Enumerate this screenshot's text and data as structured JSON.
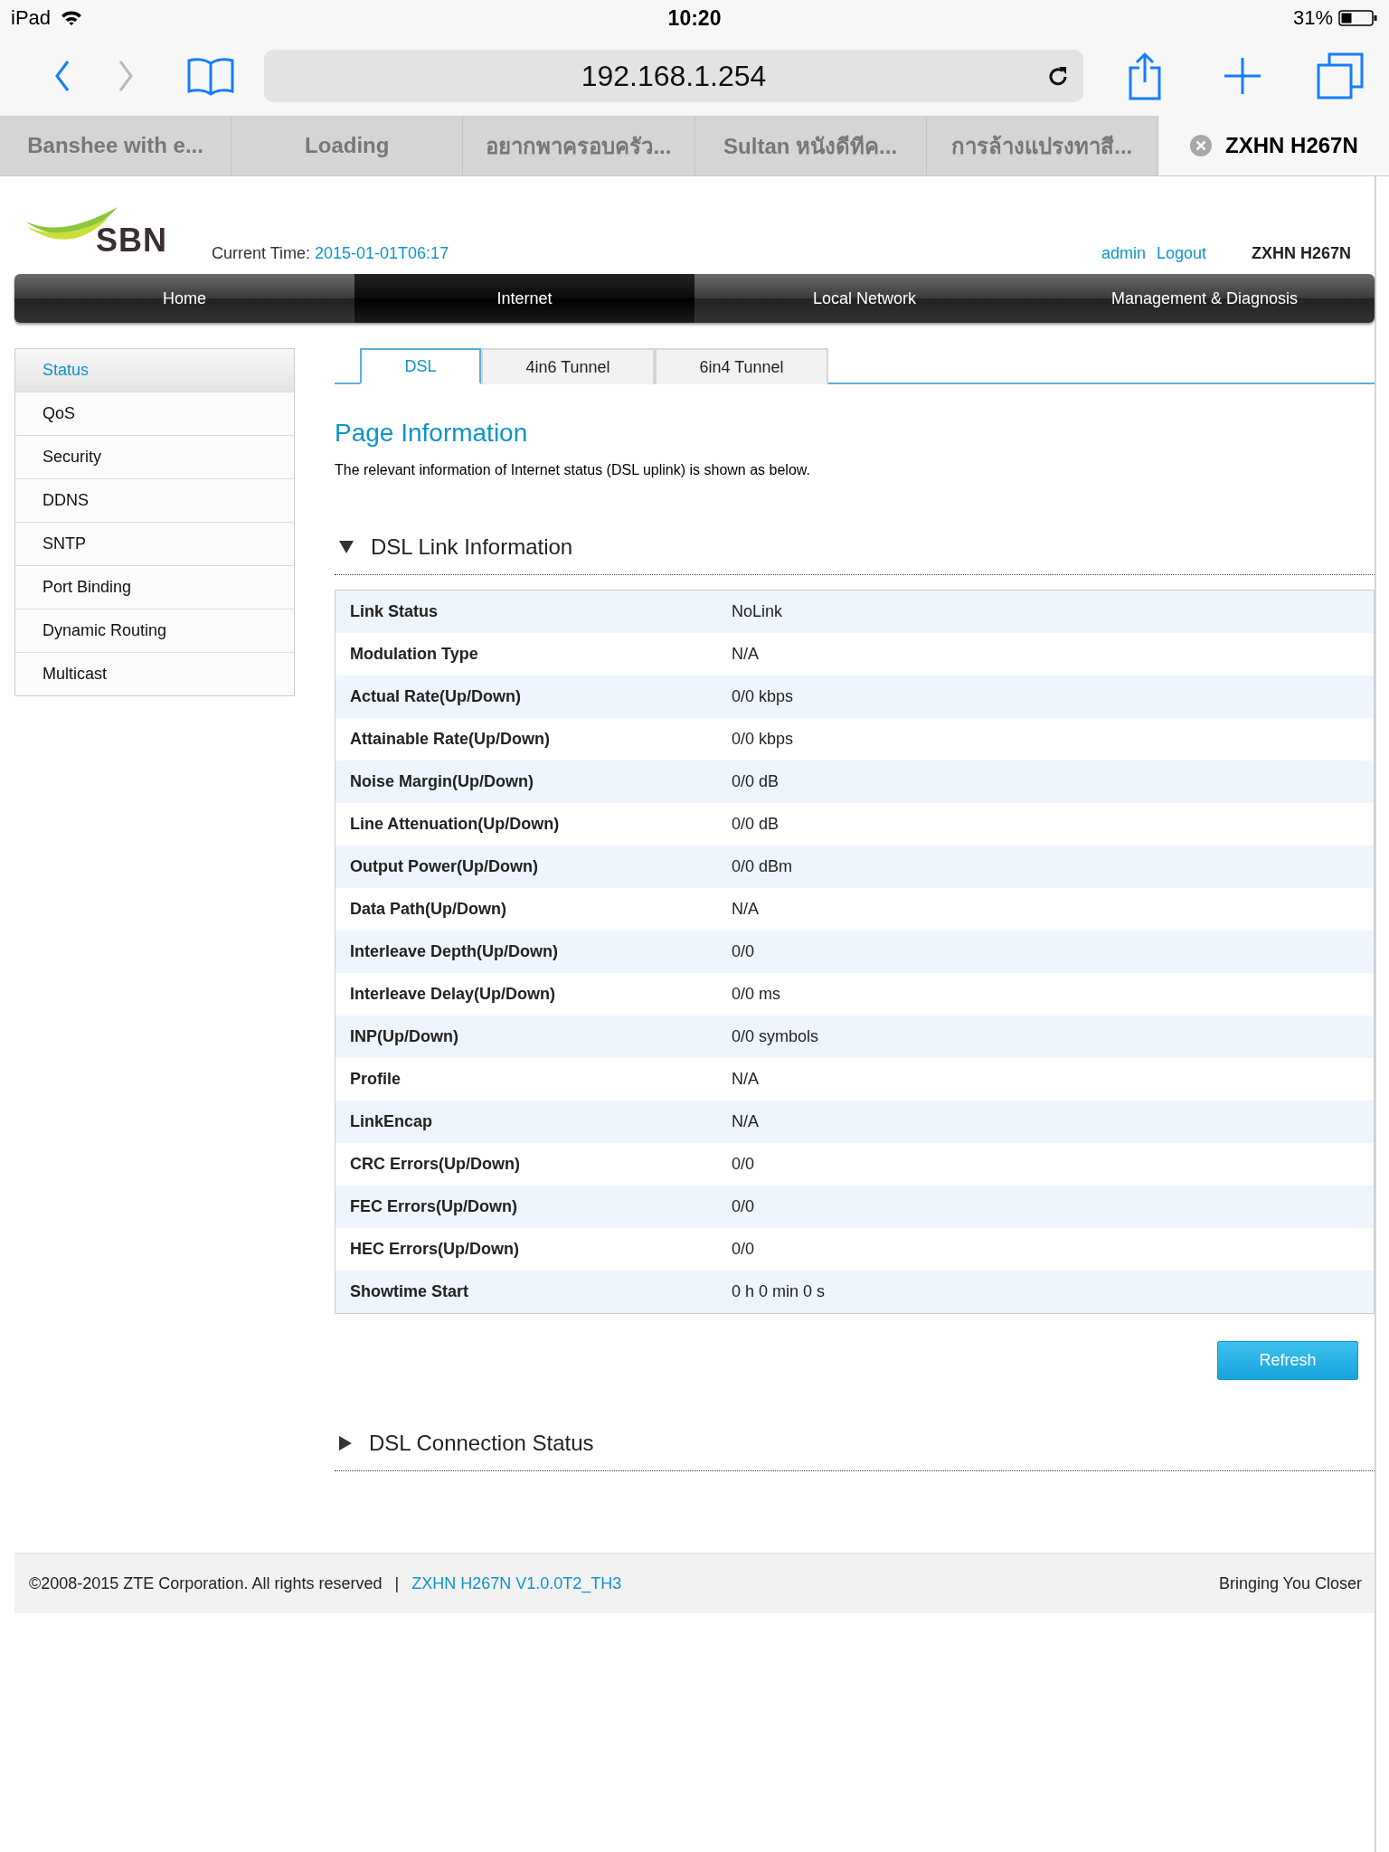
{
  "status_bar": {
    "device": "iPad",
    "time": "10:20",
    "battery": "31%"
  },
  "address_bar": {
    "url": "192.168.1.254"
  },
  "browser_tabs": [
    {
      "title": "Banshee with e...",
      "selected": false
    },
    {
      "title": "Loading",
      "selected": false
    },
    {
      "title": "อยากพาครอบครัว...",
      "selected": false
    },
    {
      "title": "Sultan หนังดีทีค...",
      "selected": false
    },
    {
      "title": "การล้างแปรงทาสี...",
      "selected": false
    },
    {
      "title": "ZXHN H267N",
      "selected": true
    }
  ],
  "header": {
    "brand": "SBN",
    "current_time_label": "Current Time:",
    "current_time": "2015-01-01T06:17",
    "user": "admin",
    "logout": "Logout",
    "model": "ZXHN H267N"
  },
  "nav": [
    {
      "label": "Home",
      "selected": false
    },
    {
      "label": "Internet",
      "selected": true
    },
    {
      "label": "Local Network",
      "selected": false
    },
    {
      "label": "Management & Diagnosis",
      "selected": false
    }
  ],
  "sidebar": [
    {
      "label": "Status",
      "selected": true
    },
    {
      "label": "QoS",
      "selected": false
    },
    {
      "label": "Security",
      "selected": false
    },
    {
      "label": "DDNS",
      "selected": false
    },
    {
      "label": "SNTP",
      "selected": false
    },
    {
      "label": "Port Binding",
      "selected": false
    },
    {
      "label": "Dynamic Routing",
      "selected": false
    },
    {
      "label": "Multicast",
      "selected": false
    }
  ],
  "tabs": [
    {
      "label": "DSL",
      "selected": true
    },
    {
      "label": "4in6 Tunnel",
      "selected": false
    },
    {
      "label": "6in4 Tunnel",
      "selected": false
    }
  ],
  "page_title": "Page Information",
  "description": "The relevant information of Internet status (DSL uplink) is shown as below.",
  "sections": [
    {
      "title": "DSL Link Information",
      "expanded": true,
      "button": "Refresh",
      "rows": [
        {
          "label": "Link Status",
          "value": "NoLink"
        },
        {
          "label": "Modulation Type",
          "value": "N/A"
        },
        {
          "label": "Actual Rate(Up/Down)",
          "value": "0/0 kbps"
        },
        {
          "label": "Attainable Rate(Up/Down)",
          "value": "0/0 kbps"
        },
        {
          "label": "Noise Margin(Up/Down)",
          "value": "0/0 dB"
        },
        {
          "label": "Line Attenuation(Up/Down)",
          "value": "0/0 dB"
        },
        {
          "label": "Output Power(Up/Down)",
          "value": "0/0 dBm"
        },
        {
          "label": "Data Path(Up/Down)",
          "value": "N/A"
        },
        {
          "label": "Interleave Depth(Up/Down)",
          "value": "0/0"
        },
        {
          "label": "Interleave Delay(Up/Down)",
          "value": "0/0 ms"
        },
        {
          "label": "INP(Up/Down)",
          "value": "0/0 symbols"
        },
        {
          "label": "Profile",
          "value": "N/A"
        },
        {
          "label": "LinkEncap",
          "value": "N/A"
        },
        {
          "label": "CRC Errors(Up/Down)",
          "value": "0/0"
        },
        {
          "label": "FEC Errors(Up/Down)",
          "value": "0/0"
        },
        {
          "label": "HEC Errors(Up/Down)",
          "value": "0/0"
        },
        {
          "label": "Showtime Start",
          "value": "0 h 0 min 0 s"
        }
      ]
    },
    {
      "title": "DSL Connection Status",
      "expanded": false
    }
  ],
  "footer": {
    "copyright": "©2008-2015 ZTE Corporation. All rights reserved",
    "separator": "|",
    "version": "ZXHN H267N V1.0.0T2_TH3",
    "slogan": "Bringing You Closer"
  }
}
